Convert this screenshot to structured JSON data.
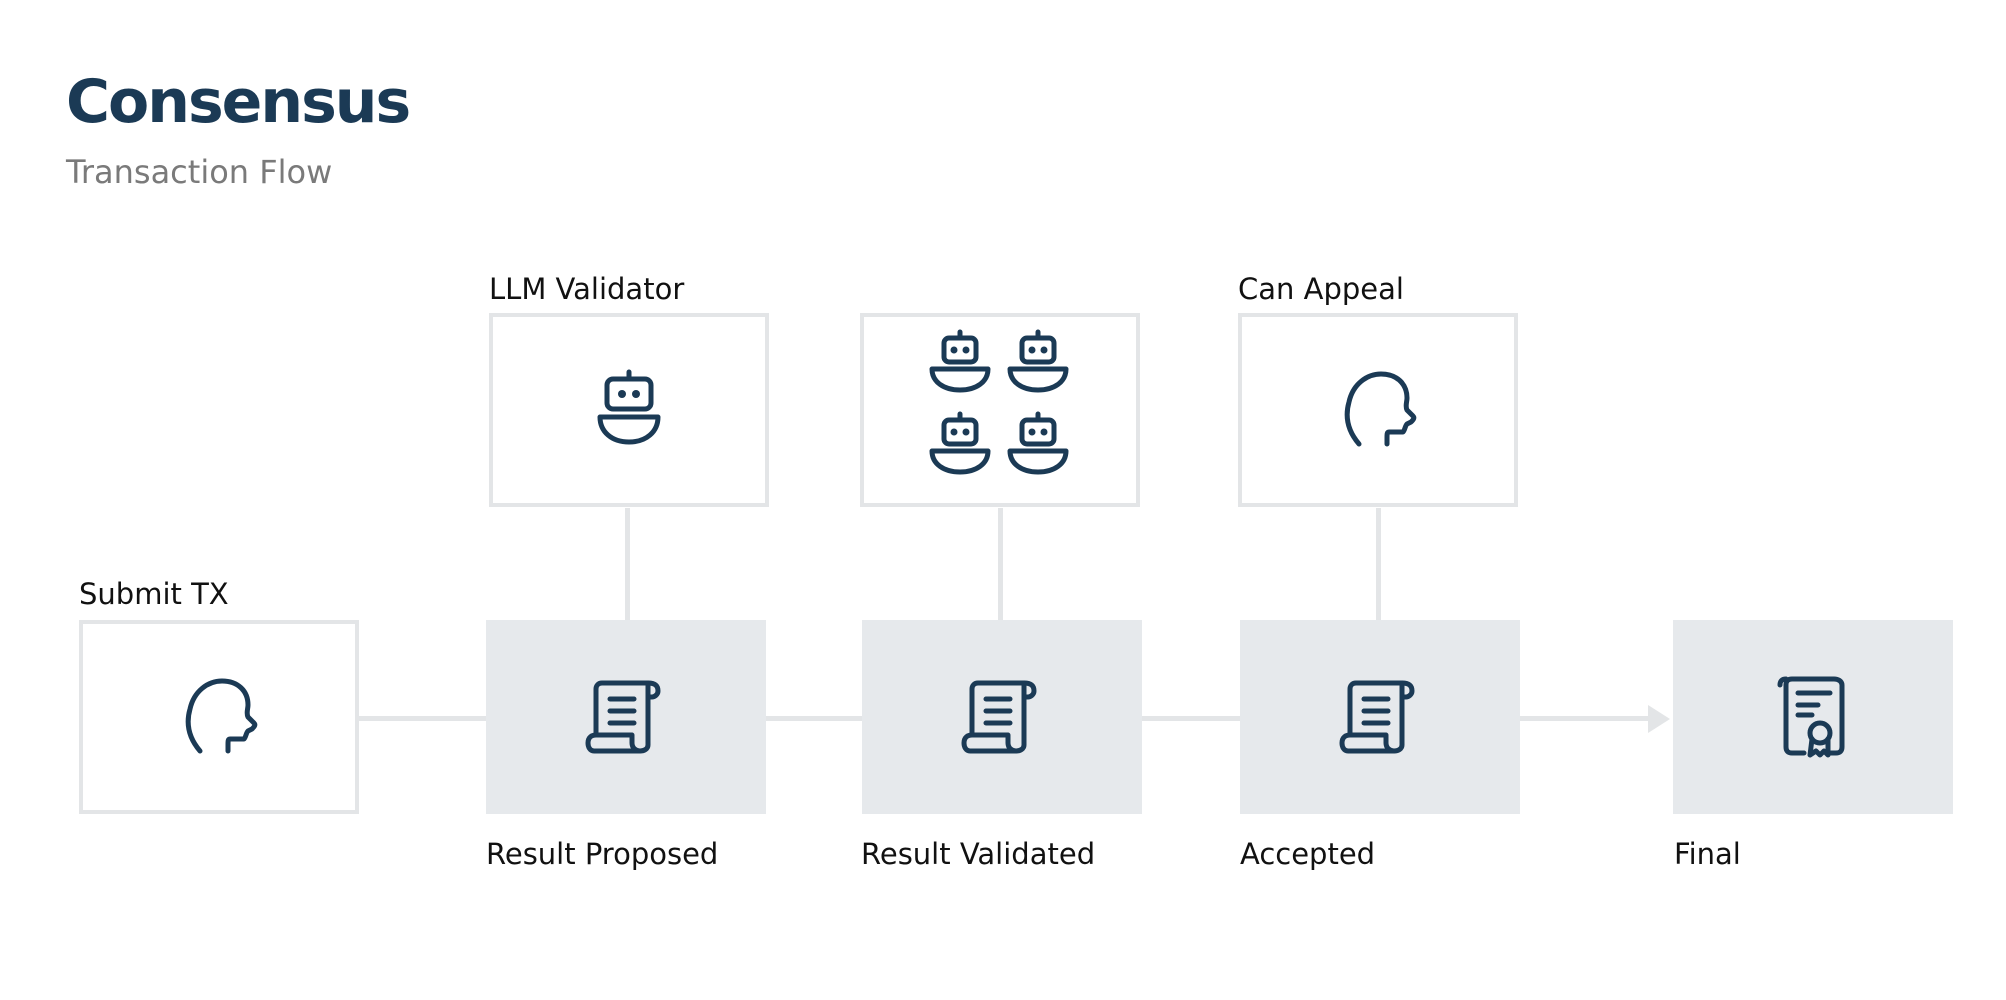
{
  "header": {
    "title": "Consensus",
    "subtitle": "Transaction Flow"
  },
  "nodes": {
    "submit_tx": {
      "label": "Submit TX",
      "icon": "person-head-icon"
    },
    "llm_validator": {
      "label": "LLM Validator",
      "icon": "robot-icon"
    },
    "validator_group": {
      "label": "",
      "icon": "robot-group-icon"
    },
    "can_appeal": {
      "label": "Can Appeal",
      "icon": "person-head-icon"
    },
    "result_proposed": {
      "label": "Result Proposed",
      "icon": "scroll-icon"
    },
    "result_validated": {
      "label": "Result Validated",
      "icon": "scroll-icon"
    },
    "accepted": {
      "label": "Accepted",
      "icon": "scroll-icon"
    },
    "final": {
      "label": "Final",
      "icon": "certificate-icon"
    }
  },
  "colors": {
    "icon": "#1b3a55",
    "title": "#1b3a55",
    "subtitle": "#7a7a7a",
    "connector": "#e3e5e7",
    "filled_box": "#e6e9ec"
  }
}
